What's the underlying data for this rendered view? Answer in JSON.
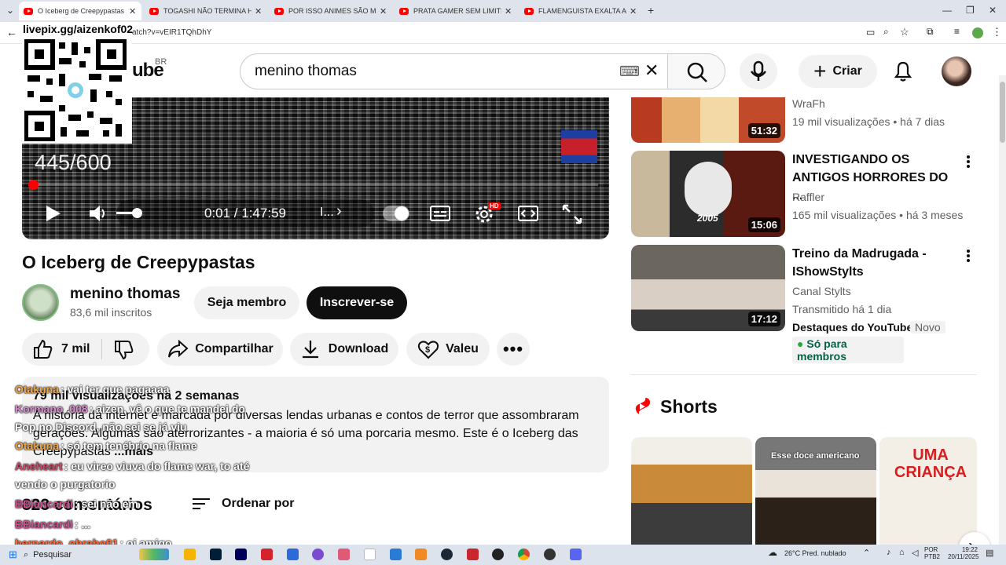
{
  "browser": {
    "tabs": [
      {
        "label": "O Iceberg de Creepypastas - Yo",
        "active": true
      },
      {
        "label": "TOGASHI NÃO TERMINA HUNT",
        "active": false
      },
      {
        "label": "POR ISSO ANIMES SÃO MELHO",
        "active": false
      },
      {
        "label": "PRATA GAMER SEM LIMITES - Y",
        "active": false
      },
      {
        "label": "FLAMENGUISTA EXALTA ARRAS",
        "active": false
      }
    ],
    "url": "atch?v=vEIR1TQhDhY"
  },
  "overlay": {
    "qr_label": "livepix.gg/aizenkof02"
  },
  "header": {
    "logo_suffix": "ube",
    "country": "BR",
    "search_value": "menino thomas",
    "create_label": "Criar"
  },
  "player": {
    "counter": "445/600",
    "time": "0:01 / 1:47:59",
    "chapter": "I...",
    "hd_badge": "HD"
  },
  "video": {
    "title": "O Iceberg de Creepypastas",
    "channel": "menino thomas",
    "subscribers": "83,6 mil inscritos",
    "member_label": "Seja membro",
    "subscribe_label": "Inscrever-se",
    "likes": "7 mil",
    "share_label": "Compartilhar",
    "download_label": "Download",
    "thanks_label": "Valeu",
    "stats": "79 mil visualizações  há 2 semanas",
    "description": "A história da internet é marcada por diversas lendas urbanas e contos de terror que assombraram gerações. Algumas são aterrorizantes - a maioria é só uma porcaria mesmo. Este é o Iceberg das Creepypastas",
    "more_label": "...mais",
    "comments_count": "823 comentários",
    "sort_label": "Ordenar por"
  },
  "chat": [
    {
      "user": "Otakuna",
      "text": ": vai ter que pagaaaa",
      "color": "#f0a64a"
    },
    {
      "user": "Kormano_008",
      "text": ": aizen, vê o que te mandei do",
      "color": "#d98bd0"
    },
    {
      "user": "",
      "text": "Pop no Discord, não sei se já viu",
      "color": "#ffffff"
    },
    {
      "user": "Otakuna",
      "text": ": só tem tenébrio na flame",
      "color": "#f0a64a"
    },
    {
      "user": "Aneheart",
      "text": ": eu vireo viuva do flame war, to até",
      "color": "#d14a6a"
    },
    {
      "user": "",
      "text": "vendo o purgatorio",
      "color": "#ffffff"
    },
    {
      "user": "BBiancardi",
      "text": ": sei não em",
      "color": "#c84d8a"
    },
    {
      "user": "BBiancardi",
      "text": ": ...",
      "color": "#c84d8a"
    },
    {
      "user": "bernardo_obrabo01",
      "text": ": oi amigo",
      "color": "#ff6a3d"
    }
  ],
  "sidebar": {
    "videos": [
      {
        "title": "",
        "channel": "WraFh",
        "meta": "19 mil visualizações • há 7 dias",
        "duration": "51:32"
      },
      {
        "title": "INVESTIGANDO OS ANTIGOS HORRORES DO ...",
        "channel": "Raffler",
        "meta": "165 mil visualizações • há 3 meses",
        "duration": "15:06",
        "thumb_text": "2005"
      },
      {
        "title": "Treino da Madrugada - IShowStylts",
        "channel": "Canal Stylts",
        "meta": "Transmitido há 1 dia",
        "duration": "17:12",
        "extra": "Destaques do YouTube",
        "badge": "Novo",
        "members": "Só para membros"
      }
    ],
    "shorts_title": "Shorts",
    "shorts": [
      {
        "caption": ""
      },
      {
        "caption": "Esse doce americano"
      },
      {
        "caption": "UMA CRIANÇA"
      }
    ]
  },
  "taskbar": {
    "search": "Pesquisar",
    "weather": "26°C  Pred. nublado",
    "lang": "POR",
    "layout": "PTB2",
    "time": "19:22",
    "date": "20/11/2025"
  }
}
